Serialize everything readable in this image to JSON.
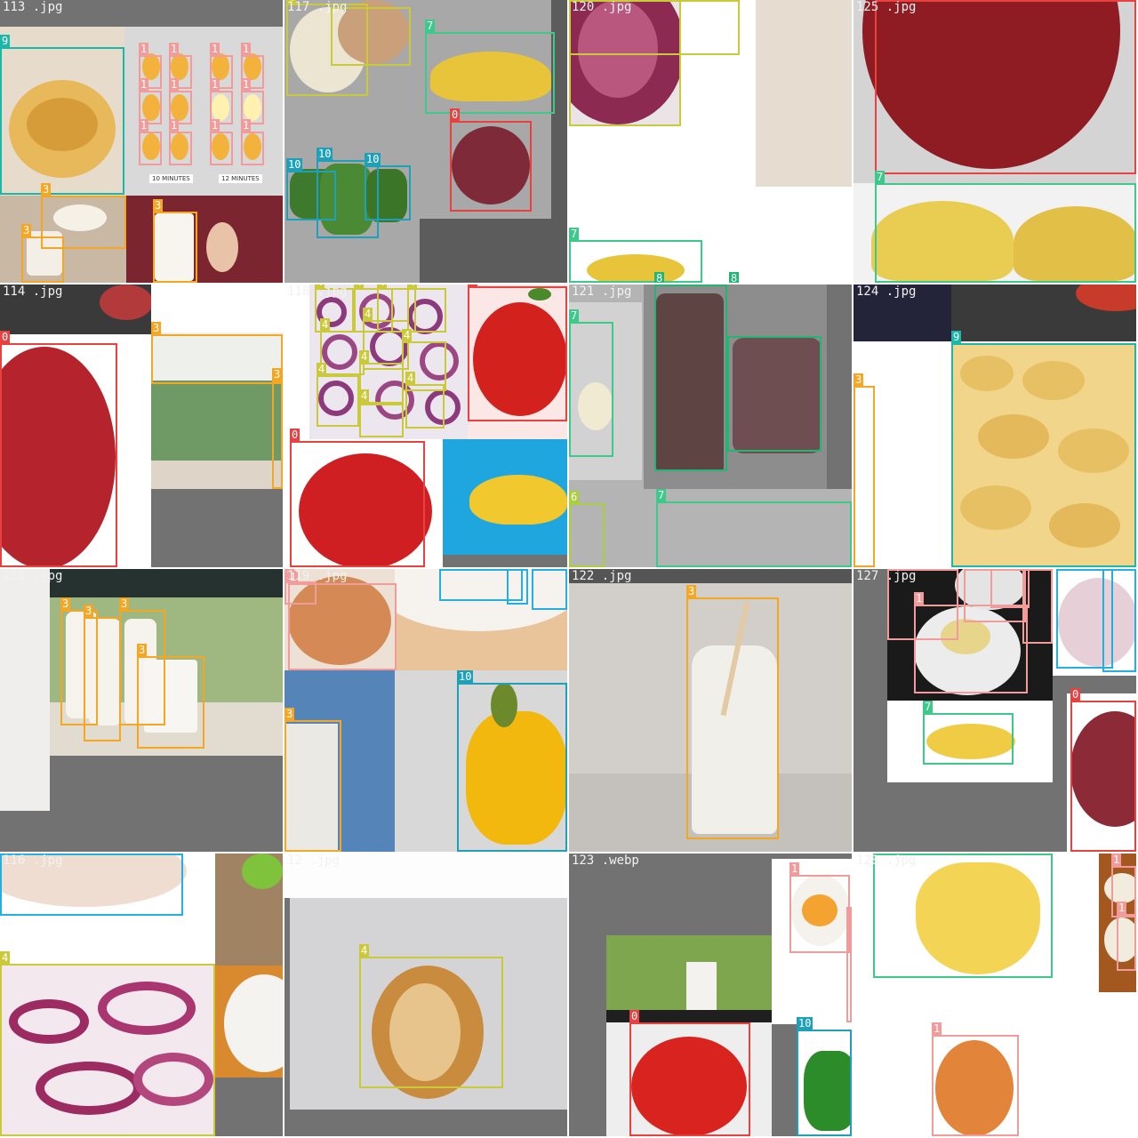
{
  "mosaic": {
    "tiles": [
      {
        "filename": "113 .jpg"
      },
      {
        "filename": "117 .jpg"
      },
      {
        "filename": "120 .jpg"
      },
      {
        "filename": "125 .jpg"
      },
      {
        "filename": "114 .jpg"
      },
      {
        "filename": "118 .jpg"
      },
      {
        "filename": "121 .jpg"
      },
      {
        "filename": "124 .jpg"
      },
      {
        "filename": "115 .jpg"
      },
      {
        "filename": "119 .jpg"
      },
      {
        "filename": "122 .jpg"
      },
      {
        "filename": "127 .jpg"
      },
      {
        "filename": "116 .jpg"
      },
      {
        "filename": "12 .jpg"
      },
      {
        "filename": "123 .webp"
      },
      {
        "filename": "128 .jpg"
      }
    ],
    "egg_captions": [
      "10 MINUTES",
      "12 MINUTES"
    ]
  },
  "class_labels": {
    "apple": "0",
    "egg": "1",
    "milk": "3",
    "onion": "4",
    "other": "6",
    "banana": "7",
    "bottle": "8",
    "pasta": "9",
    "pepper": "10",
    "fish": "11"
  },
  "colors": {
    "apple": "#e8413f",
    "egg": "#f29b9b",
    "milk": "#f5a623",
    "onion": "#c9c93a",
    "banana": "#3cc98a",
    "pasta": "#19b8a8",
    "pepper": "#1ea0b8",
    "fish": "#22b0e0"
  }
}
